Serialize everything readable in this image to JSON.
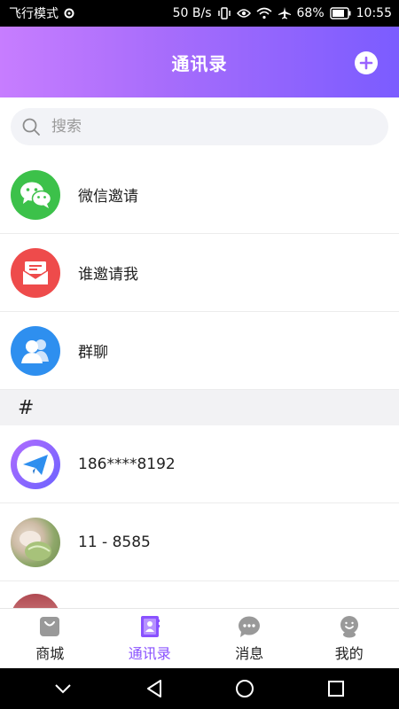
{
  "status_bar": {
    "carrier": "飞行模式",
    "speed": "50 B/s",
    "battery": "68%",
    "time": "10:55"
  },
  "header": {
    "title": "通讯录"
  },
  "search": {
    "placeholder": "搜索"
  },
  "menu_items": [
    {
      "label": "微信邀请",
      "icon": "wechat-icon",
      "color": "#3cc14a"
    },
    {
      "label": "谁邀请我",
      "icon": "invite-mail-icon",
      "color": "#ee4b4b"
    },
    {
      "label": "群聊",
      "icon": "group-chat-icon",
      "color": "#2e8fef"
    }
  ],
  "section": {
    "header": "#"
  },
  "contacts": [
    {
      "name": "186****8192",
      "avatar": "paper-plane-avatar"
    },
    {
      "name": "11 - 8585",
      "avatar": "photo-avatar"
    }
  ],
  "bottom_nav": [
    {
      "label": "商城",
      "icon": "shop-bag-icon",
      "active": false
    },
    {
      "label": "通讯录",
      "icon": "contacts-book-icon",
      "active": true
    },
    {
      "label": "消息",
      "icon": "message-bubble-icon",
      "active": false
    },
    {
      "label": "我的",
      "icon": "profile-icon",
      "active": false
    }
  ],
  "colors": {
    "accent": "#8a52ff",
    "header_gradient_start": "#c77dff",
    "header_gradient_end": "#7b5cff"
  }
}
